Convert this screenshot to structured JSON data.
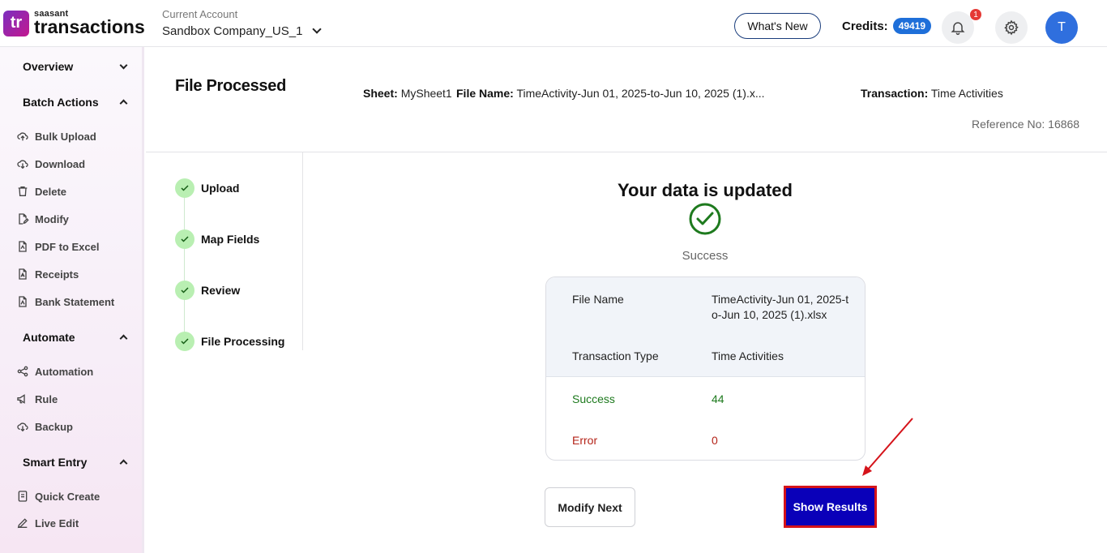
{
  "header": {
    "logo_small": "saasant",
    "logo_big": "transactions",
    "logo_mark": "tr",
    "account_label": "Current Account",
    "account_value": "Sandbox Company_US_1",
    "whats_new": "What's New",
    "credits_label": "Credits:",
    "credits_value": "49419",
    "notification_count": "1",
    "avatar_initial": "T"
  },
  "sidebar": {
    "sections": [
      {
        "label": "Overview",
        "state": "collapsed"
      },
      {
        "label": "Batch Actions",
        "state": "expanded"
      },
      {
        "label": "Automate",
        "state": "expanded"
      },
      {
        "label": "Smart Entry",
        "state": "expanded"
      }
    ],
    "batch_items": [
      {
        "label": "Bulk Upload",
        "icon": "cloud-upload-icon"
      },
      {
        "label": "Download",
        "icon": "cloud-download-icon"
      },
      {
        "label": "Delete",
        "icon": "trash-icon"
      },
      {
        "label": "Modify",
        "icon": "edit-file-icon"
      },
      {
        "label": "PDF to Excel",
        "icon": "pdf-file-icon"
      },
      {
        "label": "Receipts",
        "icon": "receipt-icon"
      },
      {
        "label": "Bank Statement",
        "icon": "bank-statement-icon"
      }
    ],
    "automate_items": [
      {
        "label": "Automation",
        "icon": "share-nodes-icon"
      },
      {
        "label": "Rule",
        "icon": "megaphone-icon"
      },
      {
        "label": "Backup",
        "icon": "cloud-backup-icon"
      }
    ],
    "smart_items": [
      {
        "label": "Quick Create",
        "icon": "document-icon"
      },
      {
        "label": "Live Edit",
        "icon": "pencil-icon"
      }
    ]
  },
  "page": {
    "title": "File Processed",
    "sheet_label": "Sheet:",
    "sheet_value": "MySheet1",
    "file_label": "File Name:",
    "file_value": "TimeActivity-Jun 01, 2025-to-Jun 10, 2025 (1).x...",
    "transaction_label": "Transaction:",
    "transaction_value": "Time Activities",
    "reference": "Reference No: 16868"
  },
  "steps": [
    {
      "label": "Upload",
      "done": true
    },
    {
      "label": "Map Fields",
      "done": true
    },
    {
      "label": "Review",
      "done": true
    },
    {
      "label": "File Processing",
      "done": true
    }
  ],
  "result": {
    "title": "Your data is updated",
    "status": "Success",
    "file_name_label": "File Name",
    "file_name_line1": "TimeActivity-Jun 01, 2025-t",
    "file_name_line2": "o-Jun 10, 2025 (1).xlsx",
    "type_label": "Transaction Type",
    "type_value": "Time Activities",
    "success_label": "Success",
    "success_value": "44",
    "error_label": "Error",
    "error_value": "0"
  },
  "actions": {
    "modify_next": "Modify Next",
    "show_results": "Show Results"
  },
  "colors": {
    "accent": "#0a00b9",
    "highlight_border": "#d5131a",
    "success": "#1e7a1e",
    "error": "#b42318",
    "badge": "#1e6fd9"
  }
}
